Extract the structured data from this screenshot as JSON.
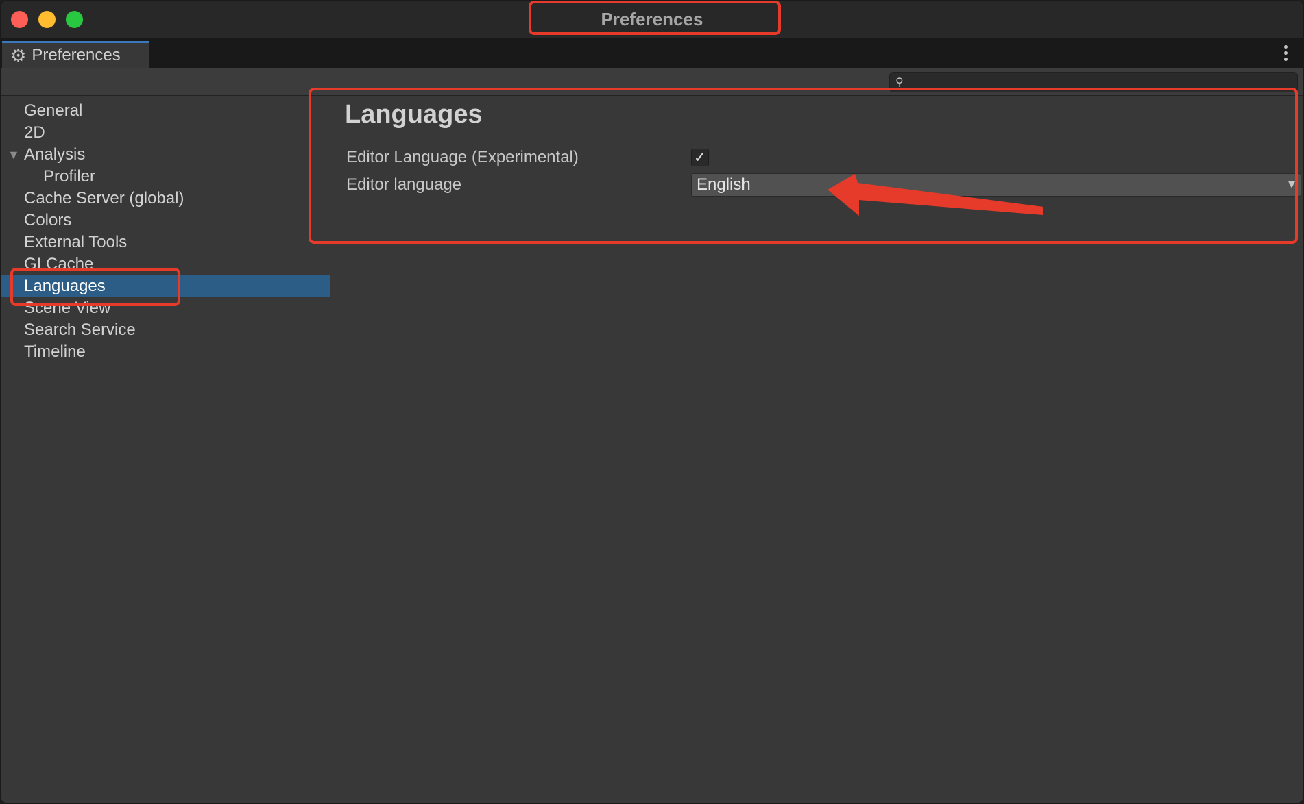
{
  "window": {
    "title": "Preferences"
  },
  "tab": {
    "label": "Preferences",
    "icon": "gear-icon"
  },
  "search": {
    "value": "",
    "placeholder": ""
  },
  "sidebar": {
    "items": [
      {
        "label": "General",
        "selected": false,
        "child": false
      },
      {
        "label": "2D",
        "selected": false,
        "child": false
      },
      {
        "label": "Analysis",
        "selected": false,
        "child": false,
        "expanded": true
      },
      {
        "label": "Profiler",
        "selected": false,
        "child": true
      },
      {
        "label": "Cache Server (global)",
        "selected": false,
        "child": false
      },
      {
        "label": "Colors",
        "selected": false,
        "child": false
      },
      {
        "label": "External Tools",
        "selected": false,
        "child": false
      },
      {
        "label": "GI Cache",
        "selected": false,
        "child": false
      },
      {
        "label": "Languages",
        "selected": true,
        "child": false
      },
      {
        "label": "Scene View",
        "selected": false,
        "child": false
      },
      {
        "label": "Search Service",
        "selected": false,
        "child": false
      },
      {
        "label": "Timeline",
        "selected": false,
        "child": false
      }
    ]
  },
  "main": {
    "title": "Languages",
    "editor_language_experimental_label": "Editor Language (Experimental)",
    "editor_language_experimental_checked": true,
    "editor_language_label": "Editor language",
    "editor_language_value": "English"
  },
  "colors": {
    "selection": "#2c5d87",
    "annotation": "#e63a2a",
    "tab_accent": "#3a79bb"
  }
}
